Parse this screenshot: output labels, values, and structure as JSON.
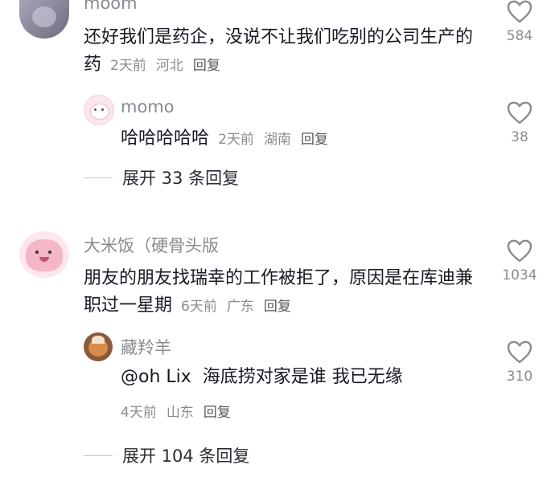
{
  "comments": [
    {
      "user": "moom",
      "text": "还好我们是药企，没说不让我们吃别的公司生产的药",
      "time": "2天前",
      "location": "河北",
      "reply_label": "回复",
      "likes": "584",
      "replies": [
        {
          "user": "momo",
          "text": "哈哈哈哈哈",
          "time": "2天前",
          "location": "湖南",
          "reply_label": "回复",
          "likes": "38"
        }
      ],
      "expand_label": "展开 33 条回复"
    },
    {
      "user": "大米饭（硬骨头版",
      "text": "朋友的朋友找瑞幸的工作被拒了，原因是在库迪兼职过一星期",
      "time": "6天前",
      "location": "广东",
      "reply_label": "回复",
      "likes": "1034",
      "replies": [
        {
          "user": "藏羚羊",
          "text": "@oh Lix  海底捞对家是谁 我已无缘",
          "time": "4天前",
          "location": "山东",
          "reply_label": "回复",
          "likes": "310"
        }
      ],
      "expand_label": "展开 104 条回复"
    }
  ],
  "icons": {
    "like": "heart-outline-icon"
  },
  "colors": {
    "text": "#161823",
    "muted": "#8a8b91",
    "heart": "#8a8b91"
  }
}
